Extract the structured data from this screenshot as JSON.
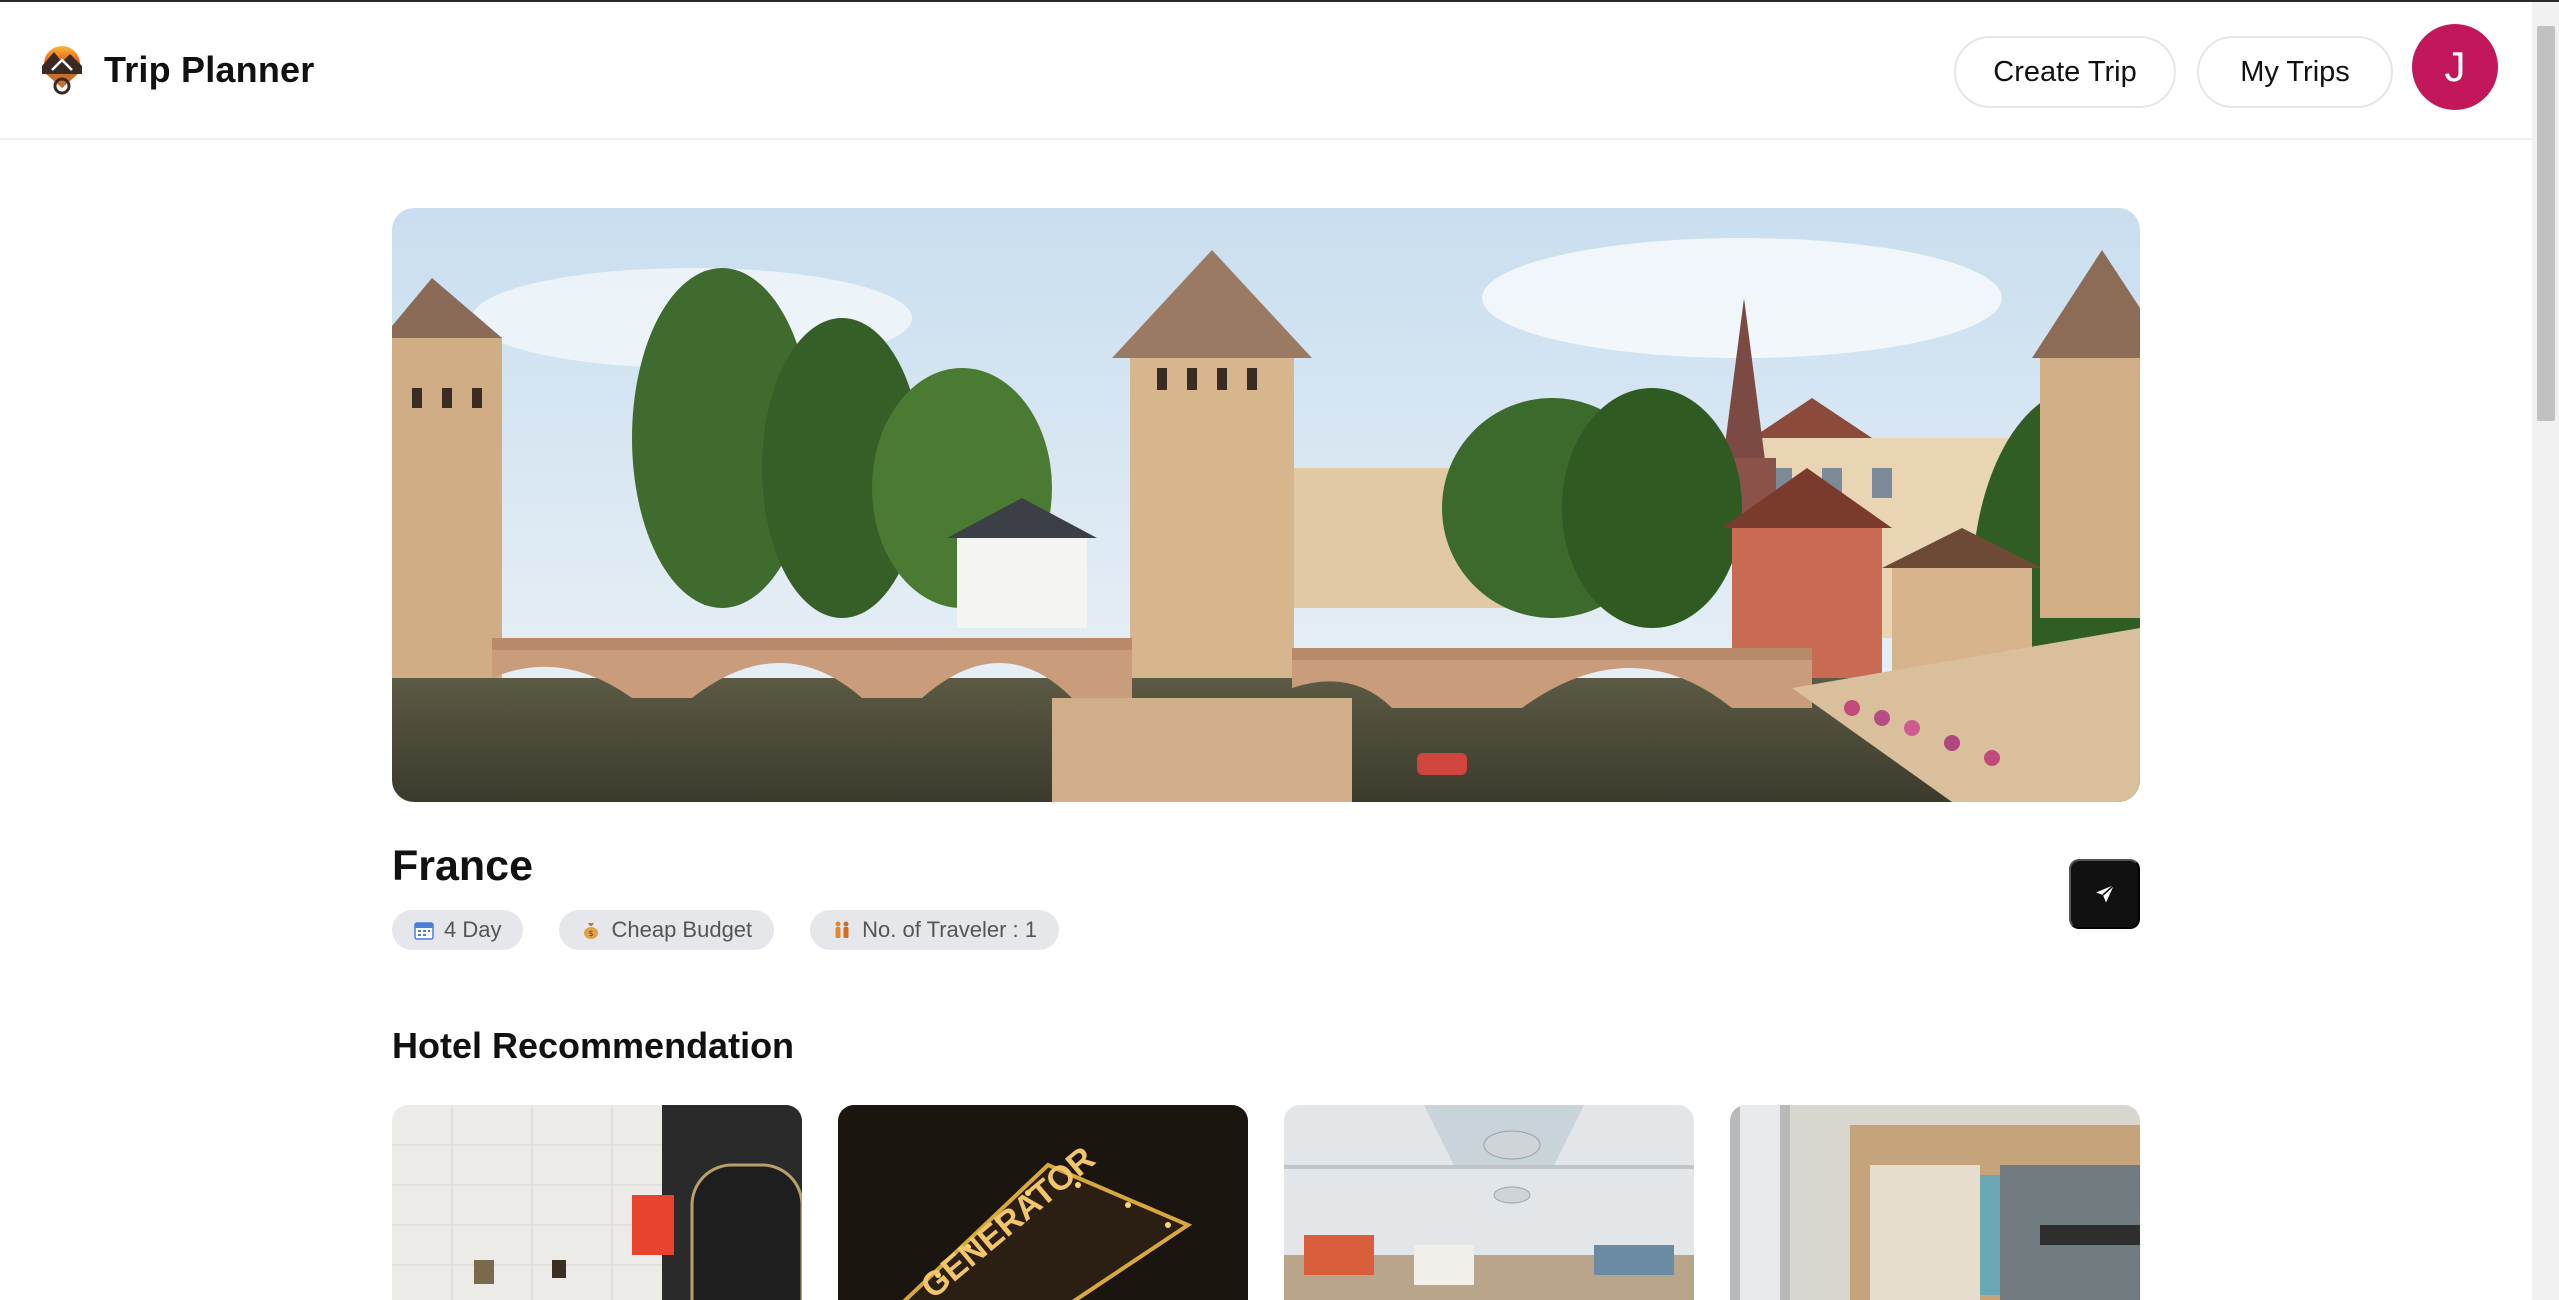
{
  "app": {
    "title": "Trip Planner"
  },
  "header": {
    "create_trip_label": "Create Trip",
    "my_trips_label": "My Trips",
    "avatar_initial": "J",
    "avatar_color": "#c2185b"
  },
  "trip": {
    "destination": "France",
    "chips": [
      {
        "icon": "calendar-icon",
        "label": "4 Day"
      },
      {
        "icon": "money-bag-icon",
        "label": "Cheap Budget"
      },
      {
        "icon": "travelers-icon",
        "label": "No. of Traveler : 1"
      }
    ]
  },
  "share": {
    "icon": "send-icon"
  },
  "hotels": {
    "section_title": "Hotel Recommendation"
  },
  "colors": {
    "accent": "#111111",
    "chip_bg": "#e5e7eb",
    "chip_text": "#555555"
  }
}
